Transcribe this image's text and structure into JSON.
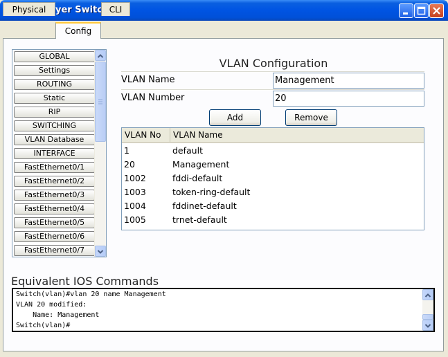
{
  "window": {
    "title": "MultiLayer Switch0",
    "accent_color": "#0054E3"
  },
  "tabs": [
    {
      "label": "Physical",
      "active": false
    },
    {
      "label": "Config",
      "active": true
    },
    {
      "label": "CLI",
      "active": false
    }
  ],
  "sidebar": {
    "items": [
      "GLOBAL",
      "Settings",
      "ROUTING",
      "Static",
      "RIP",
      "SWITCHING",
      "VLAN Database",
      "INTERFACE",
      "FastEthernet0/1",
      "FastEthernet0/2",
      "FastEthernet0/3",
      "FastEthernet0/4",
      "FastEthernet0/5",
      "FastEthernet0/6",
      "FastEthernet0/7"
    ]
  },
  "vlan_config": {
    "title": "VLAN Configuration",
    "name_label": "VLAN Name",
    "name_value": "Management",
    "number_label": "VLAN Number",
    "number_value": "20",
    "add_label": "Add",
    "remove_label": "Remove"
  },
  "vlan_table": {
    "headers": [
      "VLAN No",
      "VLAN Name"
    ],
    "rows": [
      {
        "no": "1",
        "name": "default"
      },
      {
        "no": "20",
        "name": "Management"
      },
      {
        "no": "1002",
        "name": "fddi-default"
      },
      {
        "no": "1003",
        "name": "token-ring-default"
      },
      {
        "no": "1004",
        "name": "fddinet-default"
      },
      {
        "no": "1005",
        "name": "trnet-default"
      }
    ]
  },
  "ios": {
    "title": "Equivalent IOS Commands",
    "lines": [
      "Switch(vlan)#vlan 20 name Management",
      "VLAN 20 modified:",
      "    Name: Management",
      "Switch(vlan)#"
    ]
  }
}
